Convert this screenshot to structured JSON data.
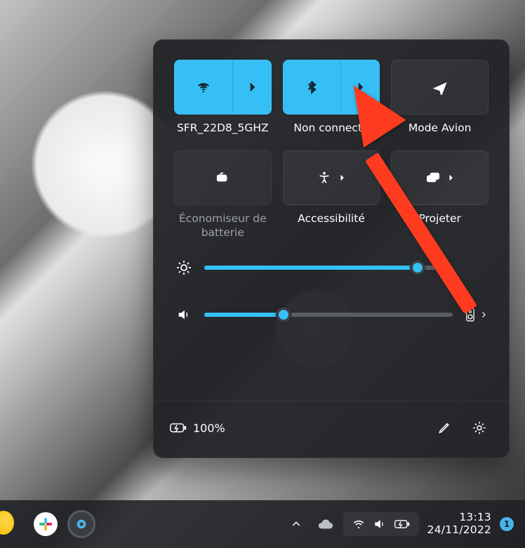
{
  "tiles": {
    "wifi": {
      "label": "SFR_22D8_5GHZ",
      "on": true
    },
    "bluetooth": {
      "label": "Non connecté",
      "on": true
    },
    "airplane": {
      "label": "Mode Avion",
      "on": false
    },
    "battery": {
      "label": "Économiseur de batterie",
      "disabled": true
    },
    "accessibility": {
      "label": "Accessibilité",
      "on": false
    },
    "project": {
      "label": "Projeter",
      "on": false
    }
  },
  "sliders": {
    "brightness": {
      "value": 86
    },
    "volume": {
      "value": 32
    }
  },
  "footer": {
    "battery_text": "100%"
  },
  "taskbar": {
    "clock_time": "13:13",
    "clock_date": "24/11/2022",
    "notif_count": "1"
  },
  "annotation": {
    "target": "bluetooth-expand"
  },
  "colors": {
    "accent": "#36bff5",
    "annotation": "#ff3b1f"
  }
}
